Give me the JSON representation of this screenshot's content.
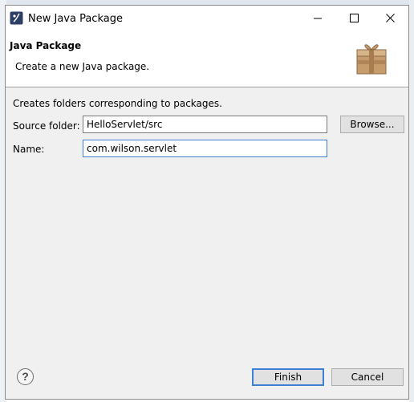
{
  "window": {
    "title": "New Java Package"
  },
  "banner": {
    "title": "Java Package",
    "description": "Create a new Java package.",
    "icon": "package-icon"
  },
  "form": {
    "info": "Creates folders corresponding to packages.",
    "source_folder_label": "Source folder:",
    "source_folder_value": "HelloServlet/src",
    "browse_label": "Browse...",
    "name_label": "Name:",
    "name_value": "com.wilson.servlet"
  },
  "footer": {
    "help_symbol": "?",
    "finish_label": "Finish",
    "cancel_label": "Cancel"
  },
  "colors": {
    "focus_border": "#3b7fd3",
    "dialog_bg": "#f0f0f0"
  }
}
